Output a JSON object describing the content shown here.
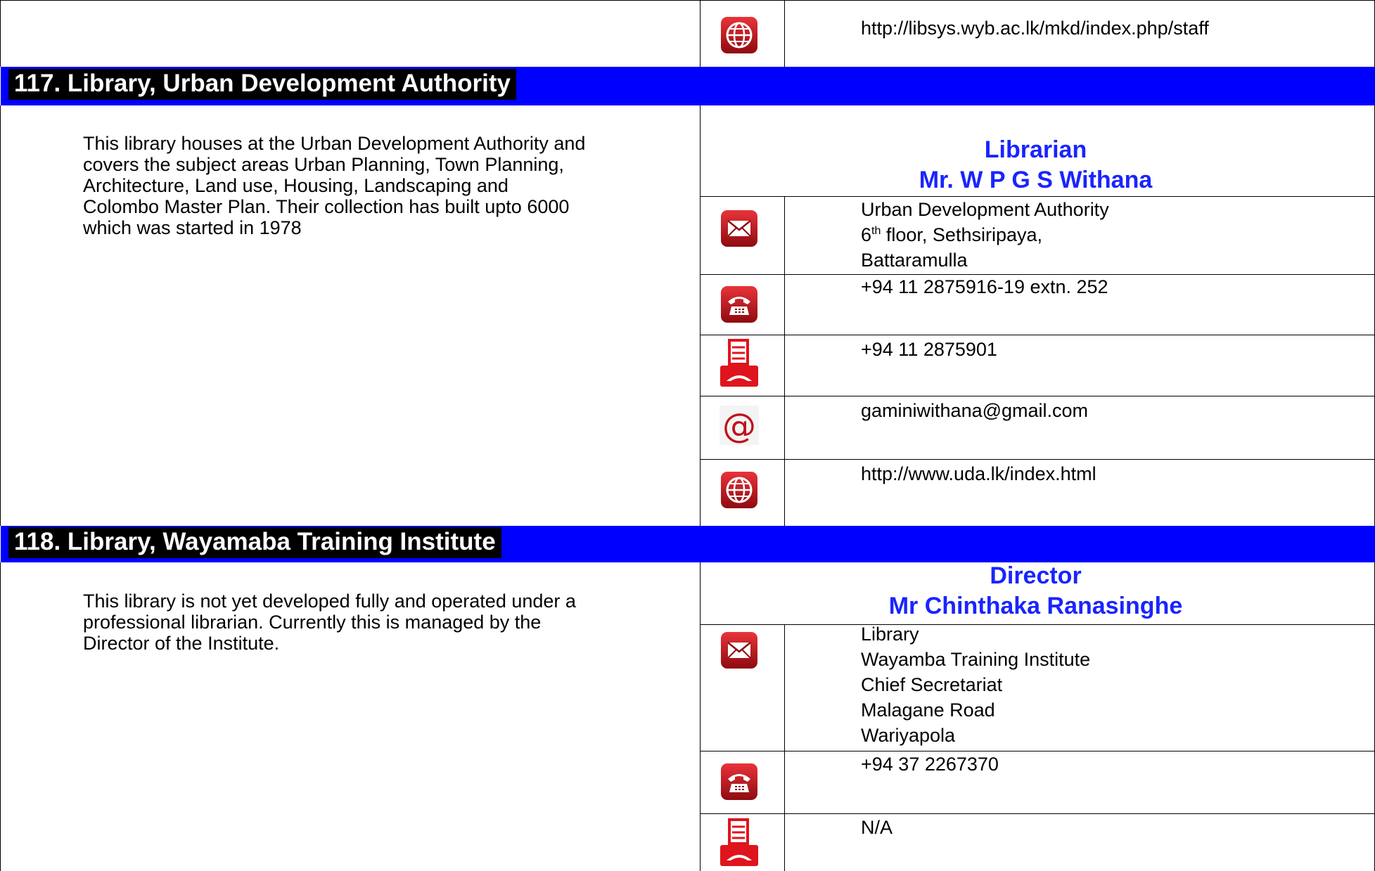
{
  "top": {
    "web": "http://libsys.wyb.ac.lk/mkd/index.php/staff"
  },
  "entry117": {
    "heading": "117.  Library, Urban Development Authority",
    "description_lines": [
      "This library houses at the Urban Development Authority and",
      "covers the subject areas Urban Planning, Town Planning,",
      "Architecture,  Land use, Housing, Landscaping and",
      "Colombo Master Plan. Their collection has built upto 6000",
      "which was started in 1978"
    ],
    "role": "Librarian",
    "name": "Mr. W P G S Withana",
    "address_line1": "Urban Development Authority",
    "address_line2_num": "6",
    "address_line2_sup": "th",
    "address_line2_rest": " floor, Sethsiripaya,",
    "address_line3": "Battaramulla",
    "phone": "+94 11  2875916-19  extn. 252",
    "fax": "+94 11 2875901",
    "email": "gaminiwithana@gmail.com",
    "web": "http://www.uda.lk/index.html"
  },
  "entry118": {
    "heading": "118.  Library,  Wayamaba Training Institute",
    "description_lines": [
      "This library is not yet developed fully and operated under a",
      "professional librarian. Currently this is managed by the",
      "Director of the Institute."
    ],
    "role": "Director",
    "name": "Mr Chinthaka Ranasinghe",
    "address_lines": [
      "Library",
      "Wayamba Training Institute",
      "Chief Secretariat",
      "Malagane Road",
      "Wariyapola"
    ],
    "phone": "+94 37 2267370",
    "fax": "N/A"
  },
  "icons": [
    "globe-icon",
    "envelope-icon",
    "telephone-icon",
    "fax-icon",
    "at-sign-icon"
  ],
  "colors": {
    "band": "#0000ff",
    "heading_text": "#ffffff",
    "role_text": "#1a24ff",
    "icon_red": "#c0121a"
  }
}
